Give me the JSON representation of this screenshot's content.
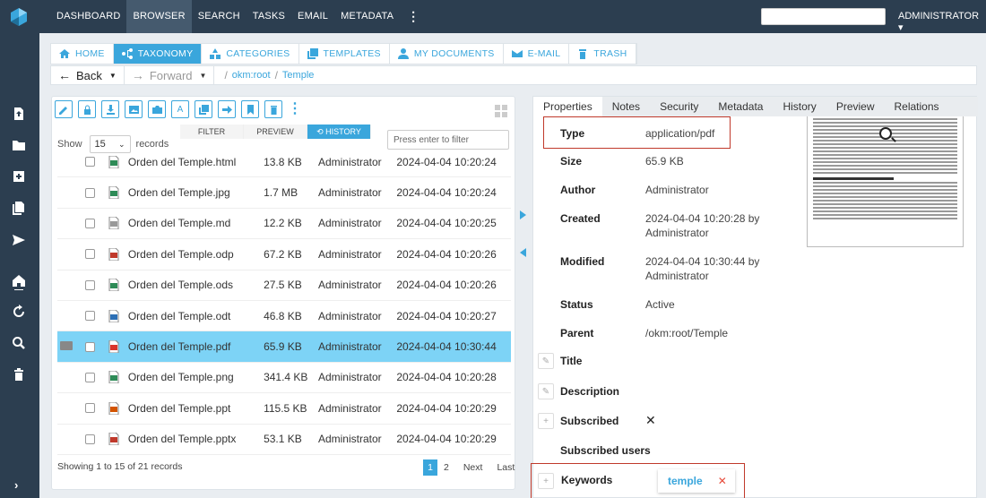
{
  "topnav": {
    "items": [
      "DASHBOARD",
      "BROWSER",
      "SEARCH",
      "TASKS",
      "EMAIL",
      "METADATA"
    ],
    "active": 1,
    "more": "⋮",
    "user": "ADMINISTRATOR ▾"
  },
  "tabs": [
    {
      "label": "HOME",
      "icon": "home-icon"
    },
    {
      "label": "TAXONOMY",
      "icon": "taxonomy-icon"
    },
    {
      "label": "CATEGORIES",
      "icon": "categories-icon"
    },
    {
      "label": "TEMPLATES",
      "icon": "templates-icon"
    },
    {
      "label": "MY DOCUMENTS",
      "icon": "user-icon"
    },
    {
      "label": "E-MAIL",
      "icon": "mail-icon"
    },
    {
      "label": "TRASH",
      "icon": "trash-icon"
    }
  ],
  "nav": {
    "back": "Back",
    "forward": "Forward",
    "crumbs": [
      "okm:root",
      "Temple"
    ]
  },
  "list": {
    "show_label": "Show",
    "page_size": "15",
    "records_label": "records",
    "subtabs": [
      "FILTER",
      "PREVIEW",
      "HISTORY"
    ],
    "filter_placeholder": "Press enter to filter",
    "rows": [
      {
        "name": "Orden del Temple.html",
        "size": "13.8 KB",
        "author": "Administrator",
        "date": "2024-04-04 10:20:24",
        "type": "html"
      },
      {
        "name": "Orden del Temple.jpg",
        "size": "1.7 MB",
        "author": "Administrator",
        "date": "2024-04-04 10:20:24",
        "type": "jpg"
      },
      {
        "name": "Orden del Temple.md",
        "size": "12.2 KB",
        "author": "Administrator",
        "date": "2024-04-04 10:20:25",
        "type": "md"
      },
      {
        "name": "Orden del Temple.odp",
        "size": "67.2 KB",
        "author": "Administrator",
        "date": "2024-04-04 10:20:26",
        "type": "odp"
      },
      {
        "name": "Orden del Temple.ods",
        "size": "27.5 KB",
        "author": "Administrator",
        "date": "2024-04-04 10:20:26",
        "type": "ods"
      },
      {
        "name": "Orden del Temple.odt",
        "size": "46.8 KB",
        "author": "Administrator",
        "date": "2024-04-04 10:20:27",
        "type": "odt"
      },
      {
        "name": "Orden del Temple.pdf",
        "size": "65.9 KB",
        "author": "Administrator",
        "date": "2024-04-04 10:30:44",
        "type": "pdf",
        "selected": true
      },
      {
        "name": "Orden del Temple.png",
        "size": "341.4 KB",
        "author": "Administrator",
        "date": "2024-04-04 10:20:28",
        "type": "png"
      },
      {
        "name": "Orden del Temple.ppt",
        "size": "115.5 KB",
        "author": "Administrator",
        "date": "2024-04-04 10:20:29",
        "type": "ppt"
      },
      {
        "name": "Orden del Temple.pptx",
        "size": "53.1 KB",
        "author": "Administrator",
        "date": "2024-04-04 10:20:29",
        "type": "pptx"
      }
    ],
    "footer": "Showing 1 to 15 of 21 records",
    "pager": [
      "1",
      "2",
      "Next",
      "Last"
    ]
  },
  "props": {
    "tabs": [
      "Properties",
      "Notes",
      "Security",
      "Metadata",
      "History",
      "Preview",
      "Relations"
    ],
    "type_label": "Type",
    "type_value": "application/pdf",
    "size_label": "Size",
    "size_value": "65.9 KB",
    "author_label": "Author",
    "author_value": "Administrator",
    "created_label": "Created",
    "created_value": "2024-04-04 10:20:28 by",
    "created_by": "Administrator",
    "modified_label": "Modified",
    "modified_value": "2024-04-04 10:30:44 by",
    "modified_by": "Administrator",
    "status_label": "Status",
    "status_value": "Active",
    "parent_label": "Parent",
    "parent_value": "/okm:root/Temple",
    "title_label": "Title",
    "description_label": "Description",
    "subscribed_label": "Subscribed",
    "subscribed_value": "✕",
    "subscribed_users_label": "Subscribed users",
    "keywords_label": "Keywords",
    "keyword_tag": "temple",
    "tag_remove": "✕"
  },
  "colors": {
    "accent": "#3aa6dc",
    "topbar": "#2c3e50",
    "selected_row": "#7dd3f6",
    "highlight": "#c0392b"
  }
}
